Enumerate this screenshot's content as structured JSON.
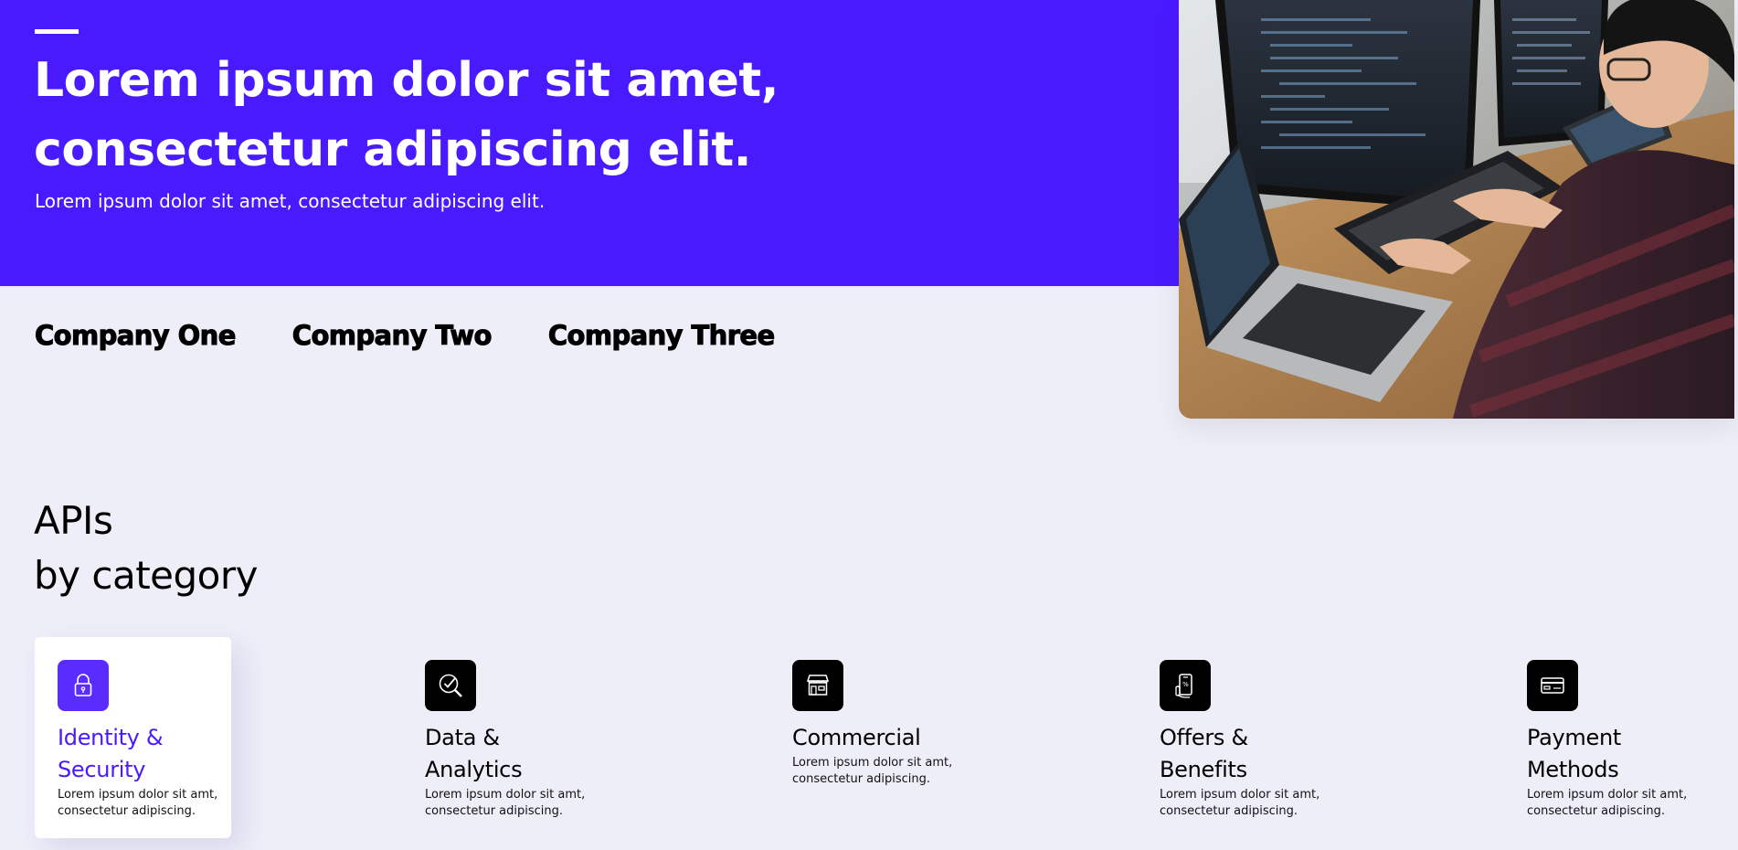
{
  "hero": {
    "title_line1": "Lorem ipsum dolor sit amet,",
    "title_line2": "consectetur adipiscing elit.",
    "subtitle": "Lorem ipsum dolor sit amet, consectetur adipiscing elit.",
    "background_color": "#4a1aff"
  },
  "companies": [
    "Company One",
    "Company Two",
    "Company Three"
  ],
  "apis": {
    "heading_line1": "APIs",
    "heading_line2": "by category"
  },
  "categories": [
    {
      "title": "Identity & Security",
      "description": "Lorem ipsum dolor sit amt, consectetur adipiscing.",
      "icon": "lock-icon",
      "active": true
    },
    {
      "title": "Data & Analytics",
      "description": "Lorem ipsum dolor sit amt, consectetur adipiscing.",
      "icon": "magnifier-check-icon",
      "active": false
    },
    {
      "title": "Commercial",
      "description": "Lorem ipsum dolor sit amt, consectetur adipiscing.",
      "icon": "storefront-icon",
      "active": false
    },
    {
      "title": "Offers & Benefits",
      "description": "Lorem ipsum dolor sit amt, consectetur adipiscing.",
      "icon": "mobile-offer-icon",
      "active": false
    },
    {
      "title": "Payment Methods",
      "description": "Lorem ipsum dolor sit amt, consectetur adipiscing.",
      "icon": "credit-card-icon",
      "active": false
    }
  ],
  "colors": {
    "accent": "#4a1aff",
    "active_icon_bg": "#5b2cff",
    "page_bg": "#eeeef9"
  }
}
